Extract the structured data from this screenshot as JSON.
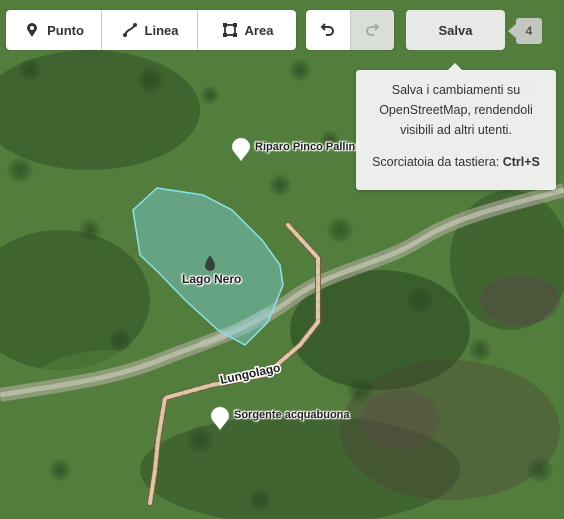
{
  "toolbar": {
    "modes": [
      {
        "label": "Punto",
        "icon": "point-icon"
      },
      {
        "label": "Linea",
        "icon": "line-icon"
      },
      {
        "label": "Area",
        "icon": "area-icon"
      }
    ],
    "undo_icon": "undo-icon",
    "redo_icon": "redo-icon",
    "save_label": "Salva",
    "change_count": "4"
  },
  "tooltip": {
    "text": "Salva i cambiamenti su OpenStreetMap, rendendoli visibili ad altri utenti.",
    "shortcut_label": "Scorciatoia da tastiera:",
    "shortcut_key": "Ctrl+S"
  },
  "map": {
    "features": {
      "poi_1": "Riparo Pinco Pallino",
      "poi_2": "Sorgente acquabuona",
      "area": "Lago Nero",
      "path": "Lungolago"
    },
    "colors": {
      "area_fill": "#7fd3d8",
      "area_stroke": "#88e4ea",
      "path_casing": "#7a5a3c",
      "path_fill": "#dcc8a8",
      "pin": "#ffffff"
    }
  }
}
